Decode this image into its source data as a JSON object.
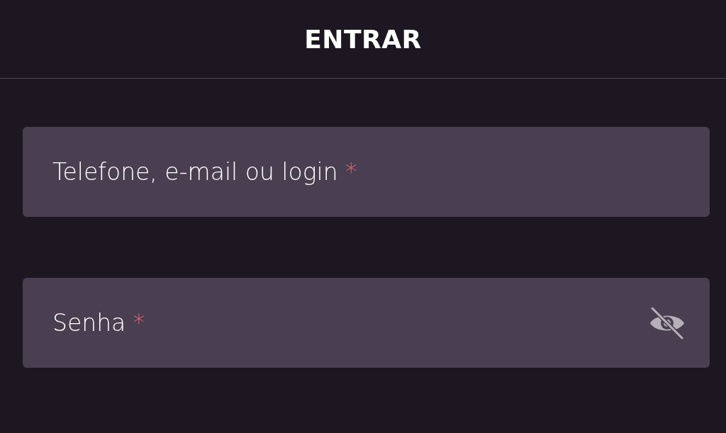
{
  "header": {
    "title": "ENTRAR"
  },
  "fields": [
    {
      "kind": "text",
      "label": "Telefone, e-mail ou login",
      "required": true,
      "required_mark": "*"
    },
    {
      "kind": "password",
      "label": "Senha",
      "required": true,
      "required_mark": "*",
      "password_hidden": true
    }
  ]
}
